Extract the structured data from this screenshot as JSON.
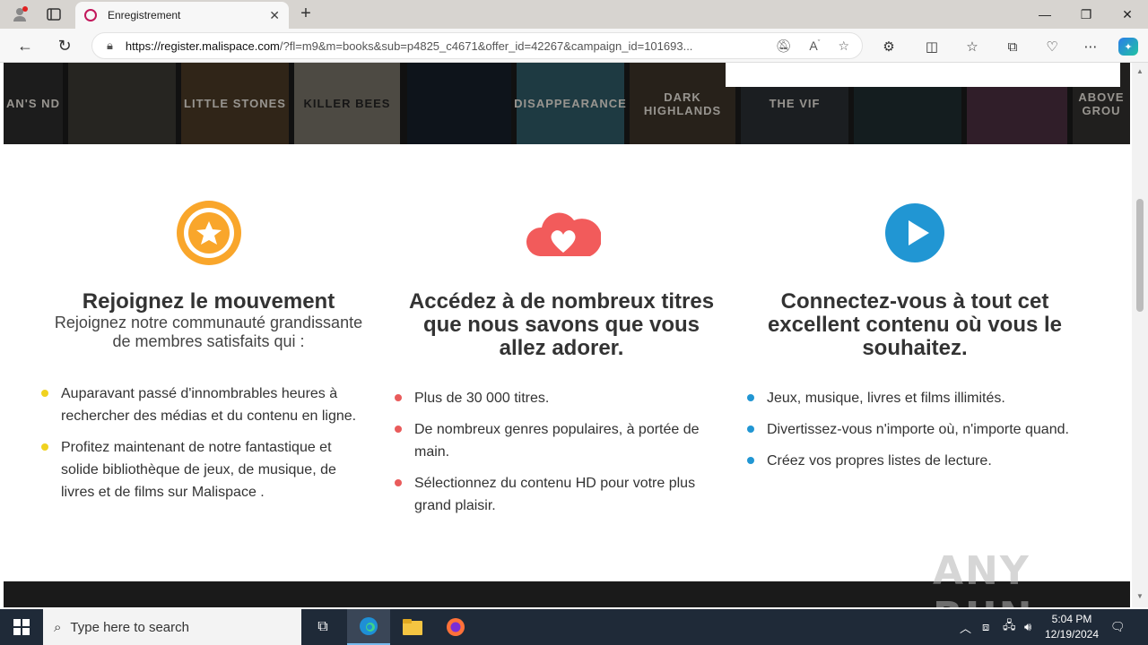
{
  "browser": {
    "tab_title": "Enregistrement",
    "url_host": "https://register.malispace.com",
    "url_path": "/?fl=m9&m=books&sub=p4825_c4671&offer_id=42267&campaign_id=101693..."
  },
  "banner": {
    "posters": [
      "AN'S ND",
      "",
      "LITTLE STONES",
      "KILLER BEES",
      "",
      "DISAPPEARANCE",
      "DARK HIGHLANDS",
      "THE VIF",
      "",
      "",
      "ABOVE GROU"
    ]
  },
  "features": [
    {
      "title": "Rejoignez le mouvement",
      "subtitle": "Rejoignez notre communauté grandissante de membres satisfaits qui :",
      "bullets": [
        "Auparavant passé d'innombrables heures à rechercher des médias et du contenu en ligne.",
        "Profitez maintenant de notre fantastique et solide bibliothèque de jeux, de musique, de livres et de films sur Malispace ."
      ],
      "color": "#f9a62b",
      "dot_color": "#f0d21f"
    },
    {
      "title": "Accédez à de nombreux titres que nous savons que vous allez adorer.",
      "bullets": [
        "Plus de 30 000 titres.",
        "De nombreux genres populaires, à portée de main.",
        "Sélectionnez du contenu HD pour votre plus grand plaisir."
      ],
      "color": "#f25b5b",
      "dot_color": "#e95b5b"
    },
    {
      "title": "Connectez-vous à tout cet excellent contenu où vous le souhaitez.",
      "bullets": [
        "Jeux, musique, livres et films illimités.",
        "Divertissez-vous n'importe où, n'importe quand.",
        "Créez vos propres listes de lecture."
      ],
      "color": "#2196d3",
      "dot_color": "#2196d3"
    }
  ],
  "watermark": "ANY RUN",
  "taskbar": {
    "search_placeholder": "Type here to search",
    "time": "5:04 PM",
    "date": "12/19/2024"
  }
}
